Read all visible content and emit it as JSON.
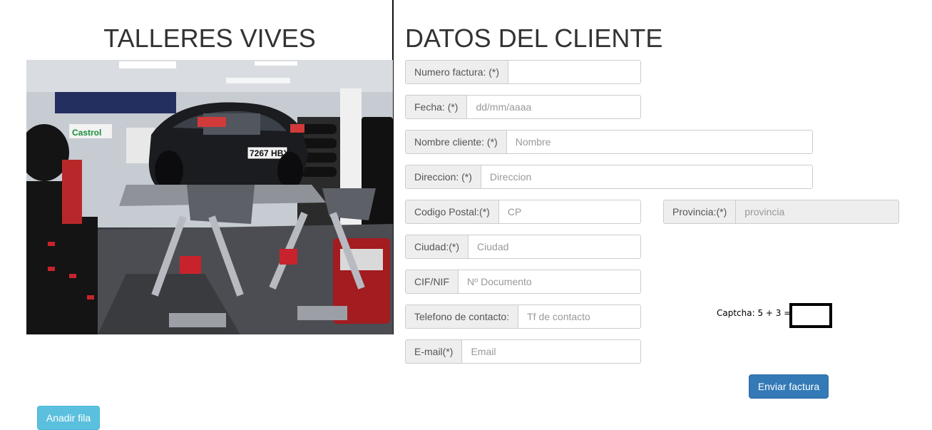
{
  "shop": {
    "title": "TALLERES VIVES"
  },
  "form": {
    "title": "DATOS DEL CLIENTE",
    "fields": [
      {
        "label": "Numero factura: (*)",
        "placeholder": "",
        "value": ""
      },
      {
        "label": "Fecha: (*)",
        "placeholder": "dd/mm/aaaa",
        "value": ""
      },
      {
        "label": "Nombre cliente: (*)",
        "placeholder": "Nombre",
        "value": ""
      },
      {
        "label": "Direccion: (*)",
        "placeholder": "Direccion",
        "value": ""
      },
      {
        "label": "Codigo Postal:(*)",
        "placeholder": "CP",
        "value": ""
      },
      {
        "label": "Provincia:(*)",
        "placeholder": "provincia",
        "value": ""
      },
      {
        "label": "Ciudad:(*)",
        "placeholder": "Ciudad",
        "value": ""
      },
      {
        "label": "CIF/NIF",
        "placeholder": "Nº Documento",
        "value": ""
      },
      {
        "label": "Telefono de contacto:",
        "placeholder": "Tf de contacto",
        "value": ""
      },
      {
        "label": "E-mail(*)",
        "placeholder": "Email",
        "value": ""
      }
    ],
    "captcha": {
      "label": "Captcha: 5 + 3 =",
      "value": ""
    },
    "submit_label": "Enviar factura"
  },
  "add_row_label": "Anadir fila",
  "photo": {
    "plate_text": "7267 HBX",
    "sign_text": "Castrol"
  },
  "colors": {
    "primary": "#337ab7",
    "info": "#5bc0de",
    "addon_bg": "#eeeeee",
    "border": "#cccccc"
  }
}
